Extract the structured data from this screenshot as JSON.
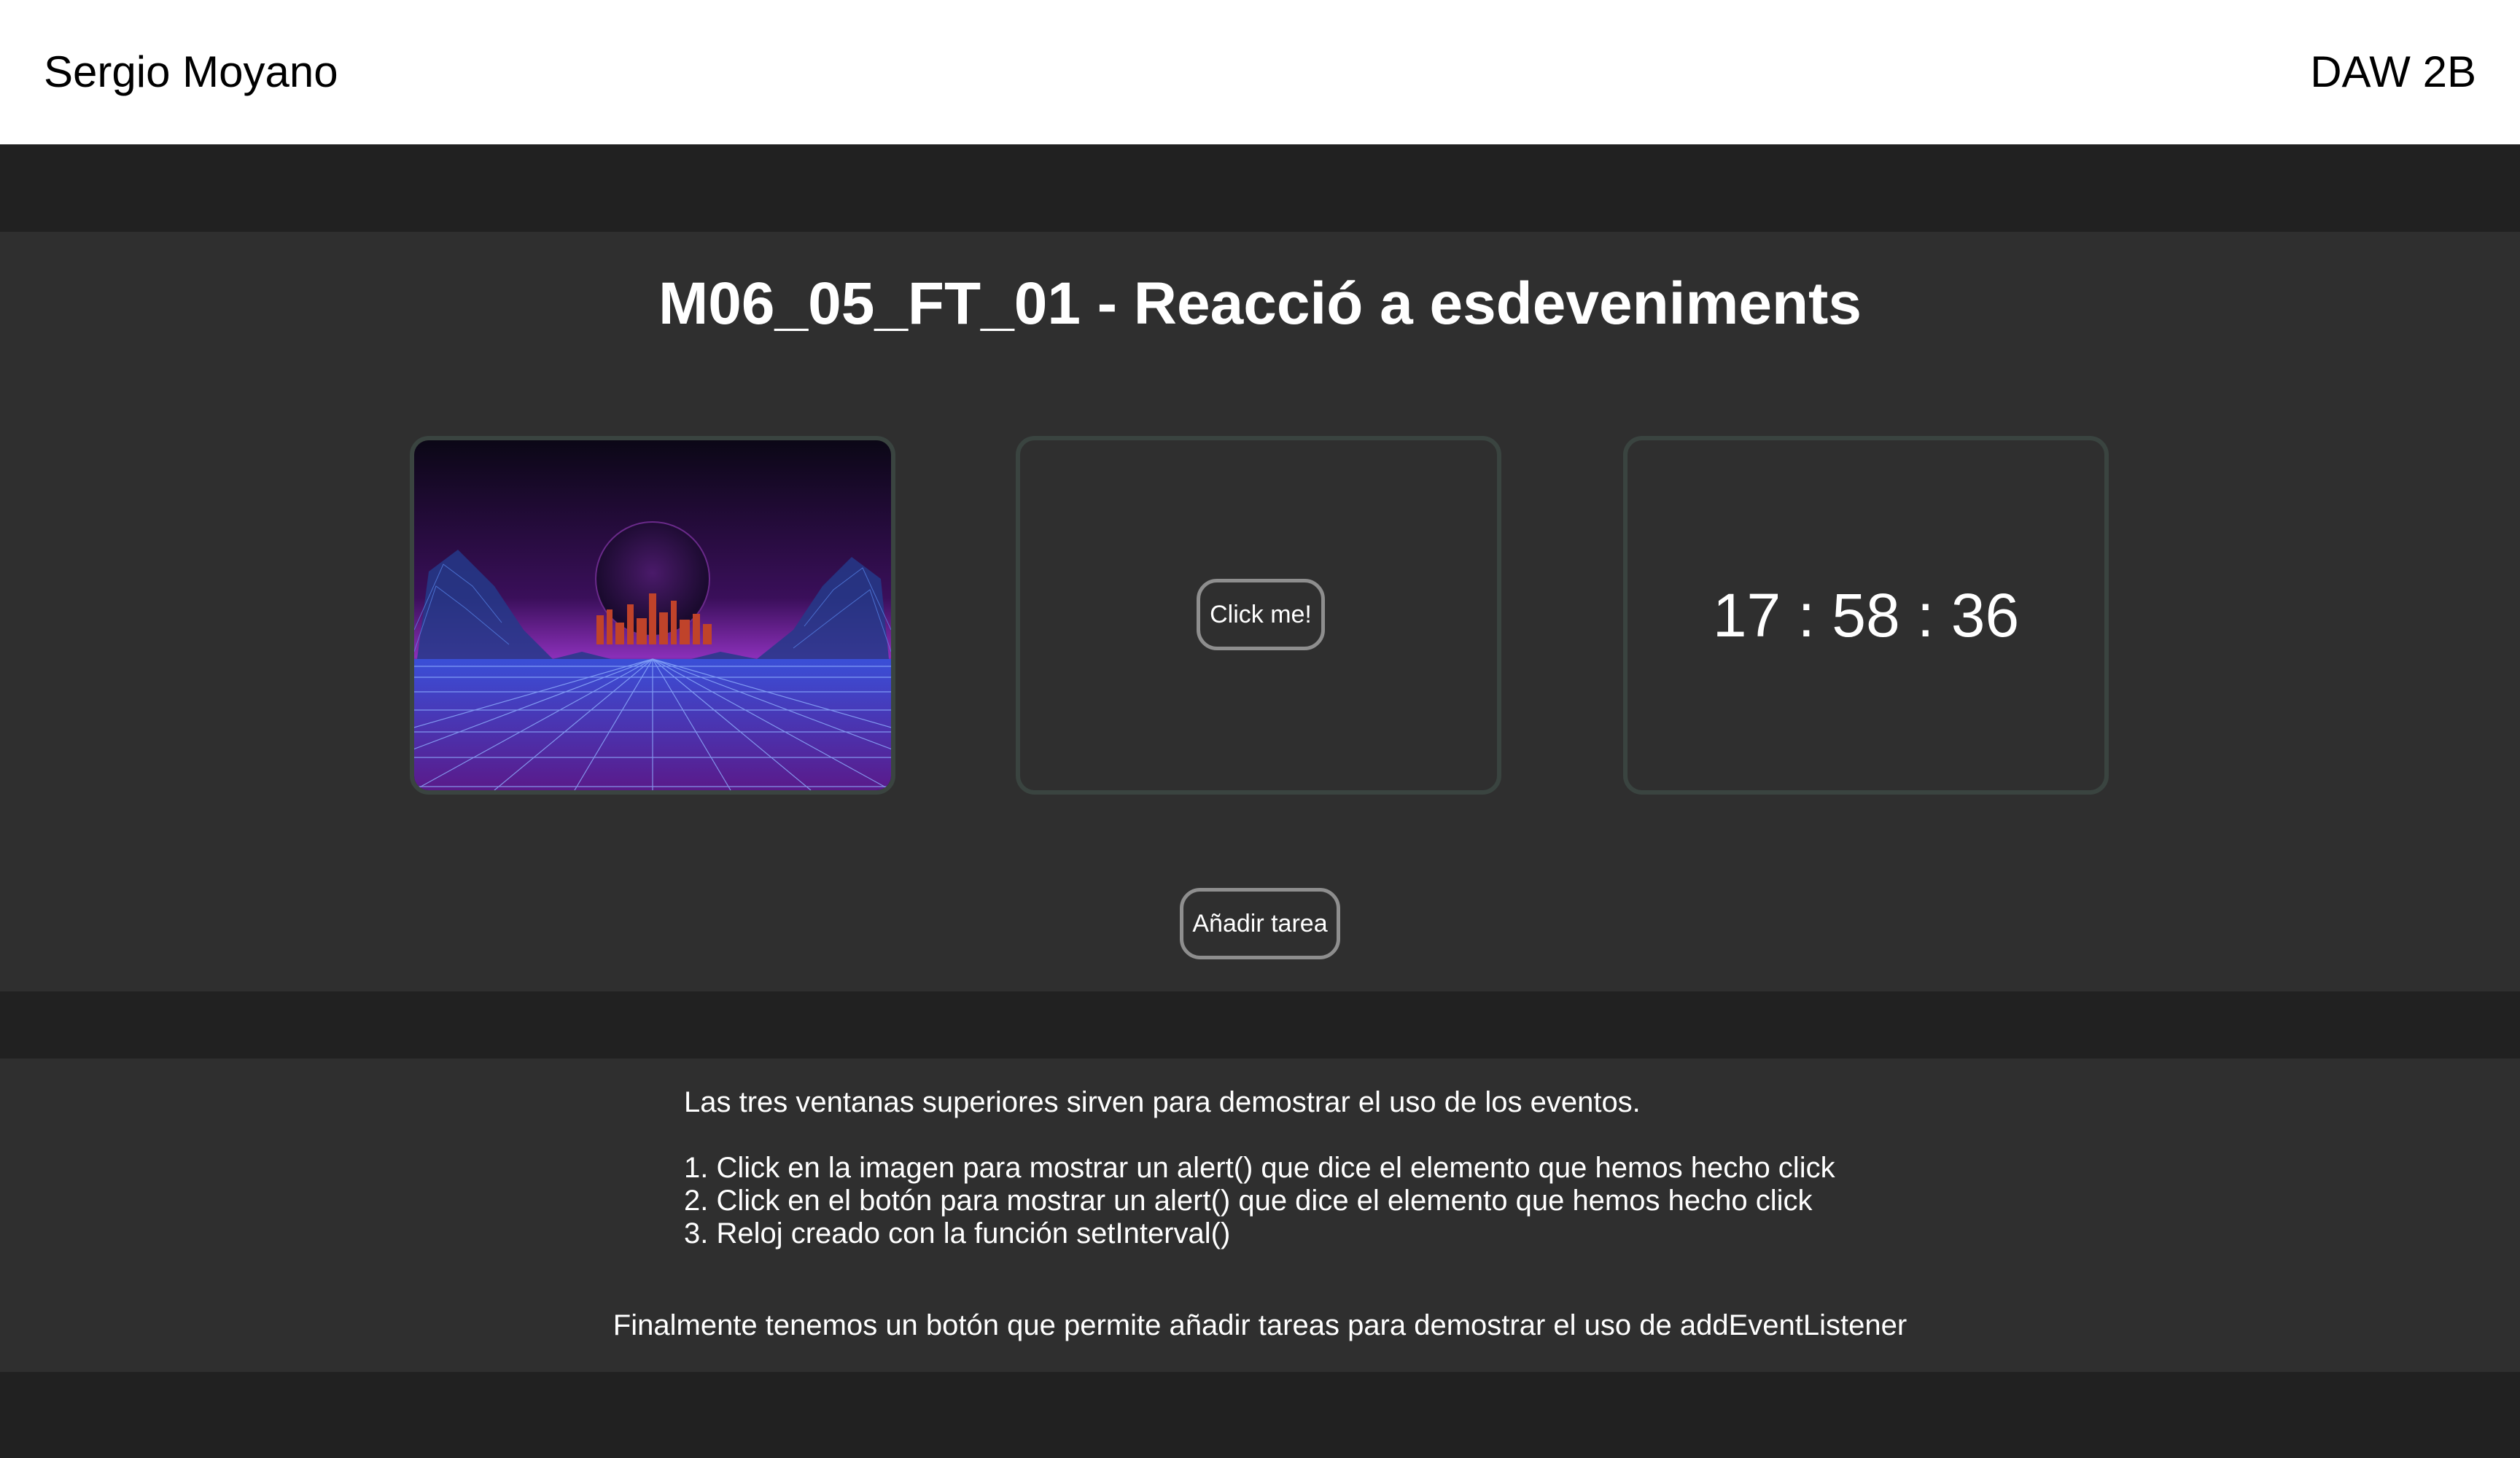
{
  "header": {
    "author": "Sergio Moyano",
    "group": "DAW 2B"
  },
  "main": {
    "title": "M06_05_FT_01 - Reacció a esdeveniments",
    "click_button": "Click me!",
    "clock": "17 : 58 : 36",
    "add_task_button": "Añadir tarea"
  },
  "info": {
    "intro": "Las tres ventanas superiores sirven para demostrar el uso de los eventos.",
    "items": [
      "1. Click en la imagen para mostrar un alert() que dice el elemento que hemos hecho click",
      "2. Click en el botón para mostrar un alert() que dice el elemento que hemos hecho click",
      "3. Reloj creado con la función setInterval()"
    ],
    "final": "Finalmente tenemos un botón que permite añadir tareas para demostrar el uso de addEventListener"
  },
  "colors": {
    "page_bg": "#212121",
    "panel_bg": "#2f2f2f",
    "header_bg": "#ffffff",
    "box_border": "#3a4440",
    "button_border": "#8e8e8e"
  },
  "image": {
    "icon": "synthwave-landscape-image"
  }
}
